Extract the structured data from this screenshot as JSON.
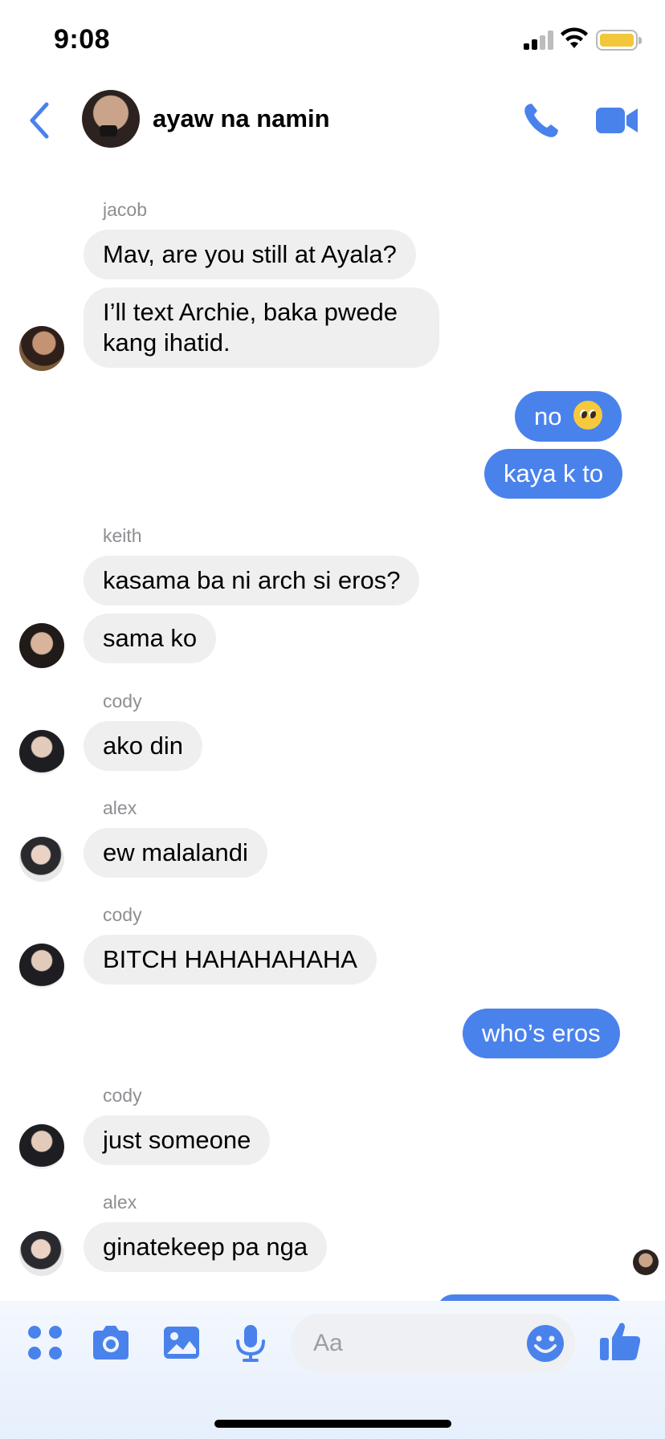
{
  "status_bar": {
    "time": "9:08"
  },
  "header": {
    "title": "ayaw na namin"
  },
  "messages": [
    {
      "sender": "jacob",
      "bubbles": [
        "Mav, are you still at Ayala?",
        "I’ll text Archie, baka pwede kang ihatid."
      ]
    },
    {
      "sender": "me",
      "bubbles": [
        "no",
        "kaya k to"
      ]
    },
    {
      "sender": "keith",
      "bubbles": [
        "kasama ba ni arch si eros?",
        "sama ko"
      ]
    },
    {
      "sender": "cody",
      "bubbles": [
        "ako din"
      ]
    },
    {
      "sender": "alex",
      "bubbles": [
        "ew malalandi"
      ]
    },
    {
      "sender": "cody",
      "bubbles": [
        "BITCH HAHAHAHAHA"
      ]
    },
    {
      "sender": "me",
      "bubbles": [
        "who’s eros"
      ]
    },
    {
      "sender": "cody",
      "bubbles": [
        "just someone"
      ]
    },
    {
      "sender": "alex",
      "bubbles": [
        "ginatekeep pa nga"
      ]
    }
  ],
  "composer": {
    "placeholder": "Aa"
  },
  "colors": {
    "accent": "#4a82ec",
    "incoming_bubble": "#efefef",
    "battery": "#f2c73a"
  },
  "icons": [
    "back-arrow-icon",
    "phone-icon",
    "video-camera-icon",
    "grid-menu-icon",
    "camera-icon",
    "gallery-icon",
    "microphone-icon",
    "smiley-icon",
    "thumbs-up-icon",
    "pleading-face-emoji"
  ]
}
